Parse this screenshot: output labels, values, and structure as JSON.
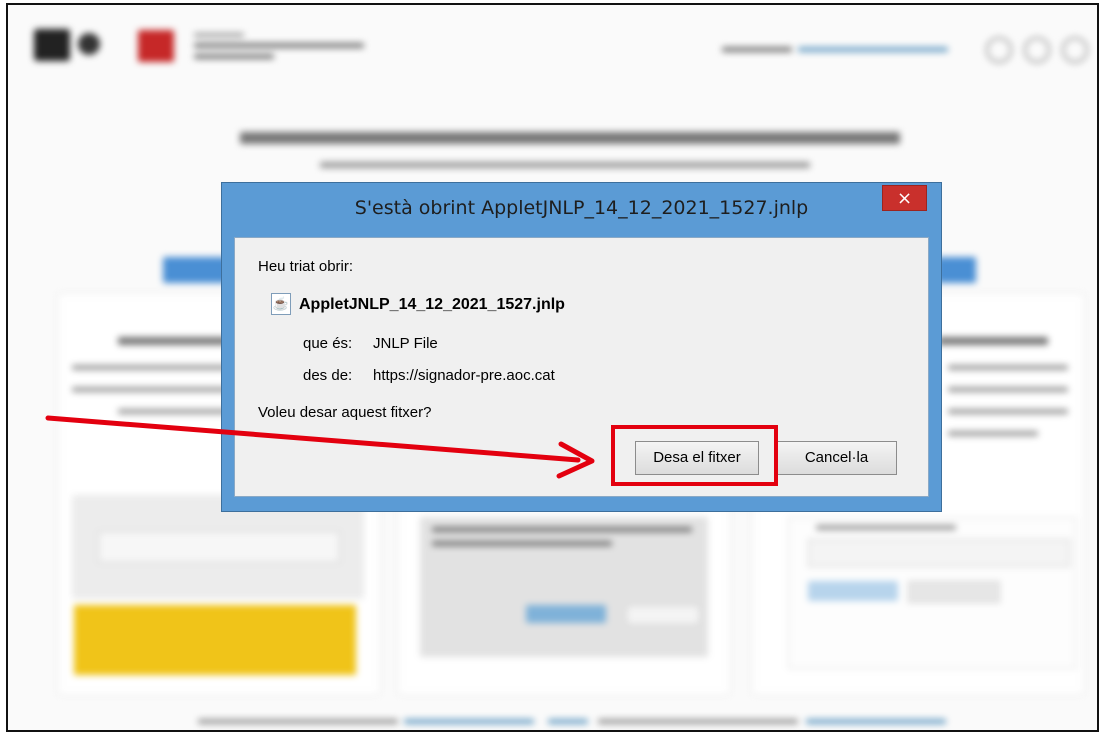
{
  "dialog": {
    "title": "S'està obrint AppletJNLP_14_12_2021_1527.jnlp",
    "close_glyph": "×",
    "intro": "Heu triat obrir:",
    "file_name": "AppletJNLP_14_12_2021_1527.jnlp",
    "file_icon": "java-file-icon",
    "type_label": "que és:",
    "type_value": "JNLP File",
    "source_label": "des de:",
    "source_value": "https://signador-pre.aoc.cat",
    "question": "Voleu desar aquest fitxer?",
    "save_button": "Desa el fitxer",
    "cancel_button": "Cancel·la"
  },
  "colors": {
    "dialog_frame": "#5b9bd5",
    "close_button": "#c9302c",
    "annotation": "#e3000f",
    "warning_box": "#f0c419"
  }
}
